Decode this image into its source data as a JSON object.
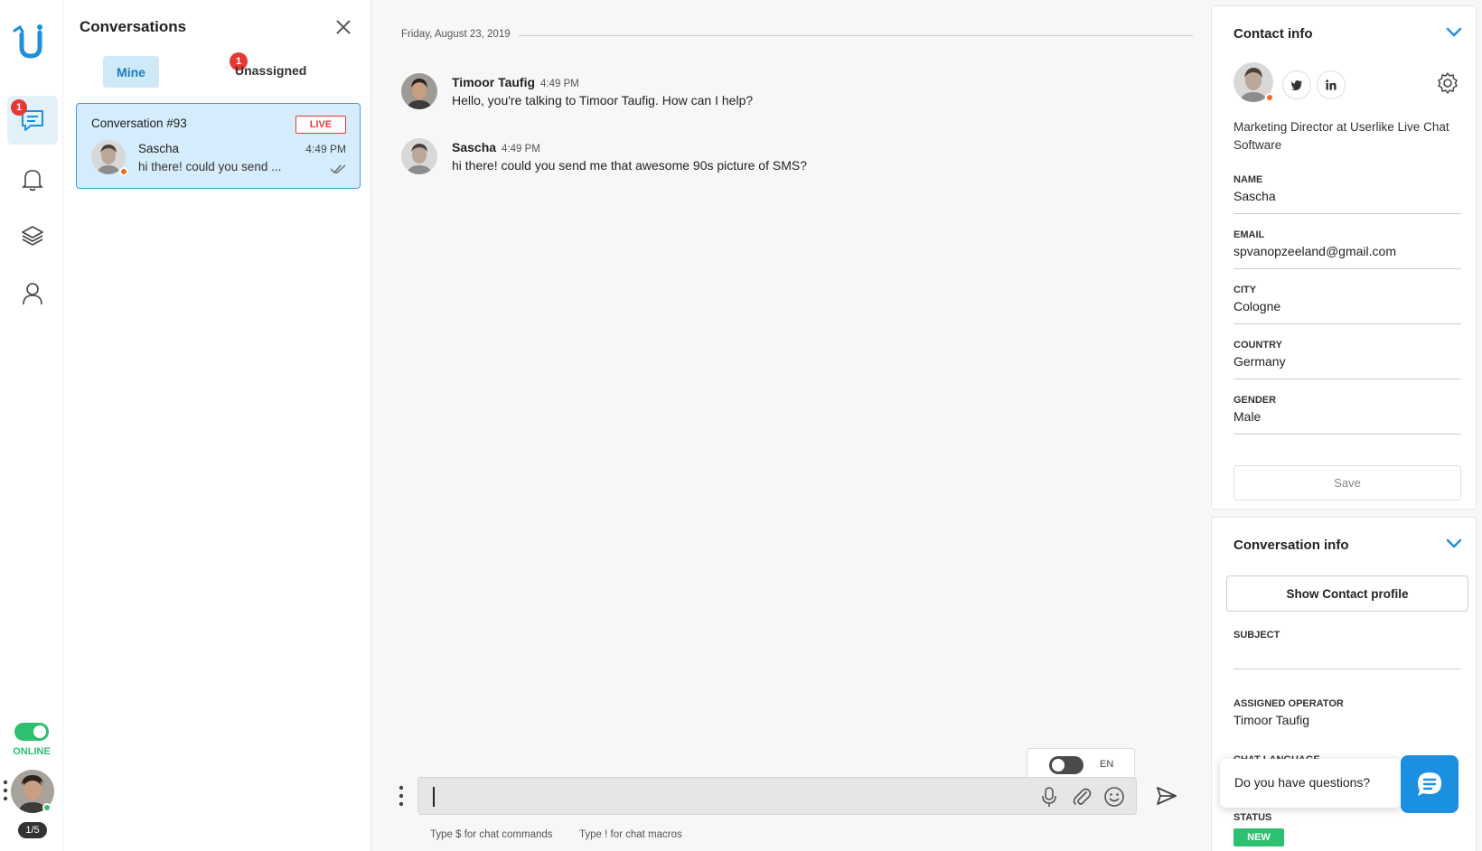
{
  "colors": {
    "accent": "#1b8fe0",
    "active_bg": "#d4ecfb",
    "live": "#e53935",
    "online": "#2fbf71",
    "away": "#f06a25"
  },
  "rail": {
    "chat_badge": "1",
    "status_label": "ONLINE",
    "page_count": "1/5",
    "icons": [
      "chat-icon",
      "bell-icon",
      "layers-icon",
      "user-icon"
    ]
  },
  "conversations": {
    "title": "Conversations",
    "tabs": [
      {
        "label": "Mine",
        "active": true
      },
      {
        "label": "Unassigned",
        "badge": "1"
      }
    ],
    "items": [
      {
        "title": "Conversation #93",
        "badge": "LIVE",
        "name": "Sascha",
        "time": "4:49 PM",
        "preview": "hi there! could you send ..."
      }
    ]
  },
  "chat": {
    "date": "Friday, August 23, 2019",
    "messages": [
      {
        "author": "Timoor Taufig",
        "time": "4:49 PM",
        "text": "Hello, you're talking to Timoor Taufig. How can I help?"
      },
      {
        "author": "Sascha",
        "time": "4:49 PM",
        "text": "hi there! could you send me that awesome 90s picture of SMS?"
      }
    ],
    "language": "EN",
    "input_value": "",
    "hints": [
      "Type $ for chat commands",
      "Type ! for chat macros"
    ]
  },
  "contact": {
    "title": "Contact info",
    "job": "Marketing Director at Userlike Live Chat Software",
    "fields": [
      {
        "label": "NAME",
        "value": "Sascha"
      },
      {
        "label": "EMAIL",
        "value": "spvanopzeeland@gmail.com"
      },
      {
        "label": "CITY",
        "value": "Cologne"
      },
      {
        "label": "COUNTRY",
        "value": "Germany"
      },
      {
        "label": "GENDER",
        "value": "Male"
      }
    ],
    "save_label": "Save"
  },
  "conversation_info": {
    "title": "Conversation info",
    "show_profile_label": "Show Contact profile",
    "subject_label": "SUBJECT",
    "subject_value": "",
    "operator_label": "ASSIGNED OPERATOR",
    "operator_value": "Timoor Taufig",
    "language_label": "CHAT LANGUAGE",
    "status_label": "STATUS",
    "status_value": "NEW"
  },
  "widget": {
    "prompt": "Do you have questions?"
  }
}
